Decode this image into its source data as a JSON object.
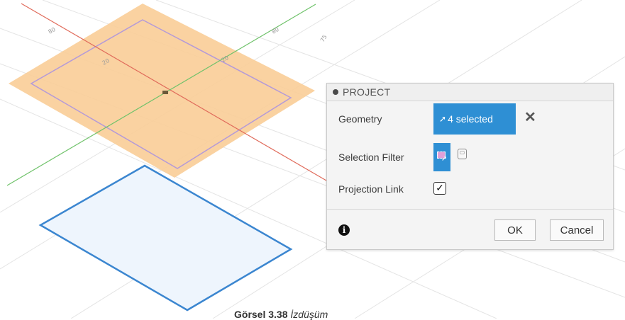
{
  "viewport": {
    "tick_labels": [
      "80",
      "80",
      "20",
      "20",
      "75"
    ],
    "colors": {
      "sketch_plane": "#f9cd97",
      "x_axis": "#e06a5a",
      "y_axis": "#6fc26a",
      "projected_sketch": "#3b86d0"
    }
  },
  "dialog": {
    "title": "PROJECT",
    "geometry": {
      "label": "Geometry",
      "value": "4 selected",
      "clear_icon": "close-icon"
    },
    "selection_filter": {
      "label": "Selection Filter",
      "icons": [
        "select-filter-icon",
        "body-filter-icon"
      ]
    },
    "projection_link": {
      "label": "Projection Link",
      "checked": true,
      "check_glyph": "✓"
    },
    "info_glyph": "i",
    "ok_label": "OK",
    "cancel_label": "Cancel",
    "accent": "#2e8fd4"
  },
  "caption": {
    "main": "Görsel 3.38",
    "sub": "İzdüşüm"
  }
}
